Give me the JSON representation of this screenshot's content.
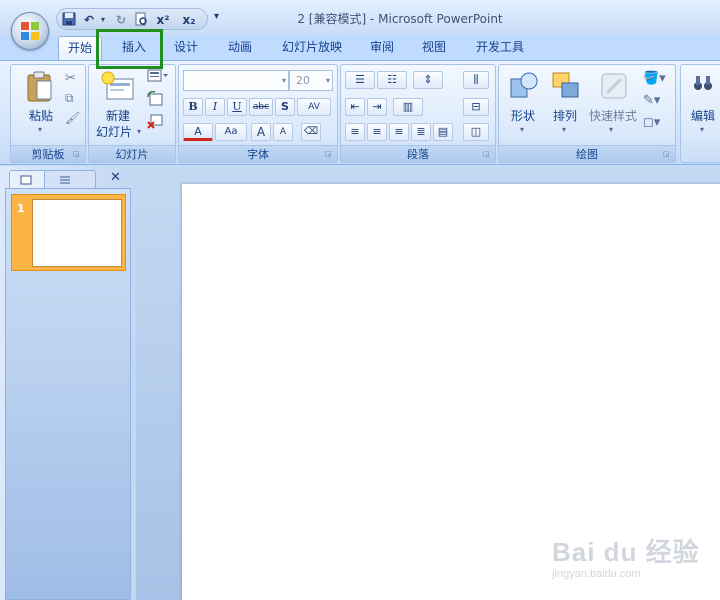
{
  "window": {
    "title": "2 [兼容模式] - Microsoft PowerPoint"
  },
  "quick_access": {
    "more_label": "▾"
  },
  "tabs": [
    {
      "label": "开始",
      "selected": true
    },
    {
      "label": "插入",
      "highlighted": true
    },
    {
      "label": "设计"
    },
    {
      "label": "动画"
    },
    {
      "label": "幻灯片放映"
    },
    {
      "label": "审阅"
    },
    {
      "label": "视图"
    },
    {
      "label": "开发工具"
    }
  ],
  "ribbon": {
    "clipboard": {
      "paste_label": "粘贴",
      "group_label": "剪贴板"
    },
    "slides": {
      "new_slide_line1": "新建",
      "new_slide_line2": "幻灯片",
      "group_label": "幻灯片"
    },
    "font": {
      "font_name": "",
      "font_size": "20",
      "group_label": "字体",
      "buttons": [
        "B",
        "I",
        "U",
        "abc",
        "S",
        "AV",
        "A",
        "Aa",
        "A",
        "A",
        "⌫"
      ]
    },
    "paragraph": {
      "group_label": "段落"
    },
    "drawing": {
      "shapes_label": "形状",
      "arrange_label": "排列",
      "quick_styles_label": "快速样式",
      "group_label": "绘图"
    },
    "editing": {
      "edit_label": "编辑"
    }
  },
  "slides_panel": {
    "slide_number": "1"
  },
  "watermark": {
    "logo": "Bai du 经验",
    "url": "jingyan.baidu.com"
  },
  "colors": {
    "highlight": "#1f8f1f",
    "thumb_selected": "#fbb547",
    "ribbon_text": "#15428b"
  }
}
